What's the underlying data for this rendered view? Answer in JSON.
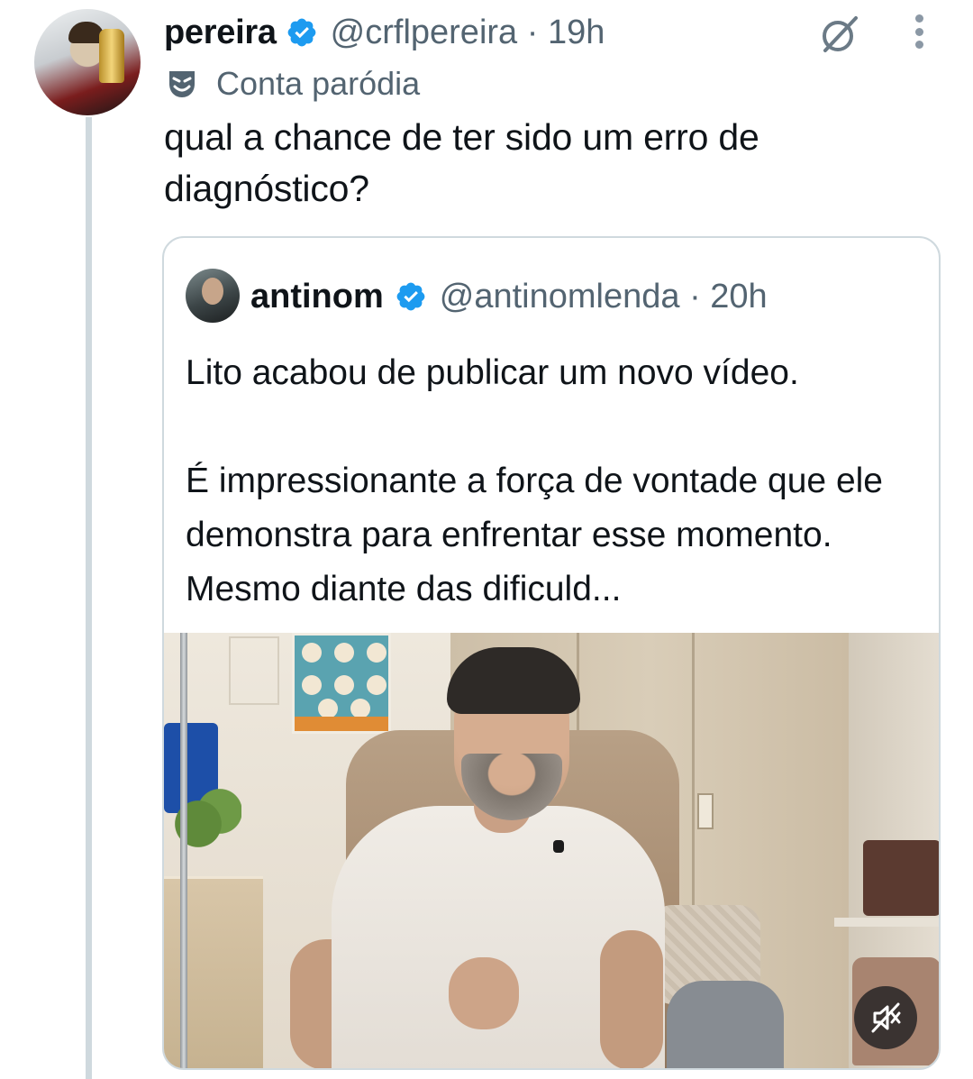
{
  "tweet": {
    "author_name": "pereira",
    "handle_time": "@crflpereira · 19h",
    "parody_label": "Conta paródia",
    "text": "qual a chance de ter sido um erro de diagnóstico?"
  },
  "quoted_tweet": {
    "author_name": "antinom",
    "handle_time": "@antinomlenda · 20h",
    "text": "Lito acabou de publicar um novo vídeo.\n\nÉ impressionante a força de vontade que ele demonstra para enfrentar esse momento. Mesmo diante das dificuld..."
  },
  "icons": {
    "verified": "verified-badge-icon",
    "grok": "grok-icon",
    "more": "more-options-icon",
    "parody": "parody-mask-icon",
    "mute": "muted-speaker-icon"
  },
  "colors": {
    "text": "#0f1419",
    "secondary": "#536471",
    "verified": "#1d9bf0",
    "border": "#cfd9de"
  }
}
